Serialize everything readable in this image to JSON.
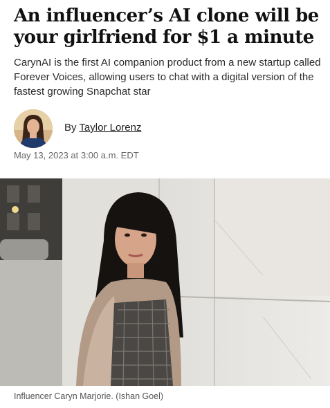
{
  "article": {
    "headline": "An influencer’s AI clone will be your girlfriend for $1 a minute",
    "dek": "CarynAI is the first AI companion product from a new startup called Forever Voices, allowing users to chat with a digital version of the fastest growing Snapchat star",
    "byline_prefix": "By",
    "author": "Taylor Lorenz",
    "date": "May 13, 2023 at 3:00 a.m. EDT",
    "caption": "Influencer Caryn Marjorie. (Ishan Goel)"
  }
}
